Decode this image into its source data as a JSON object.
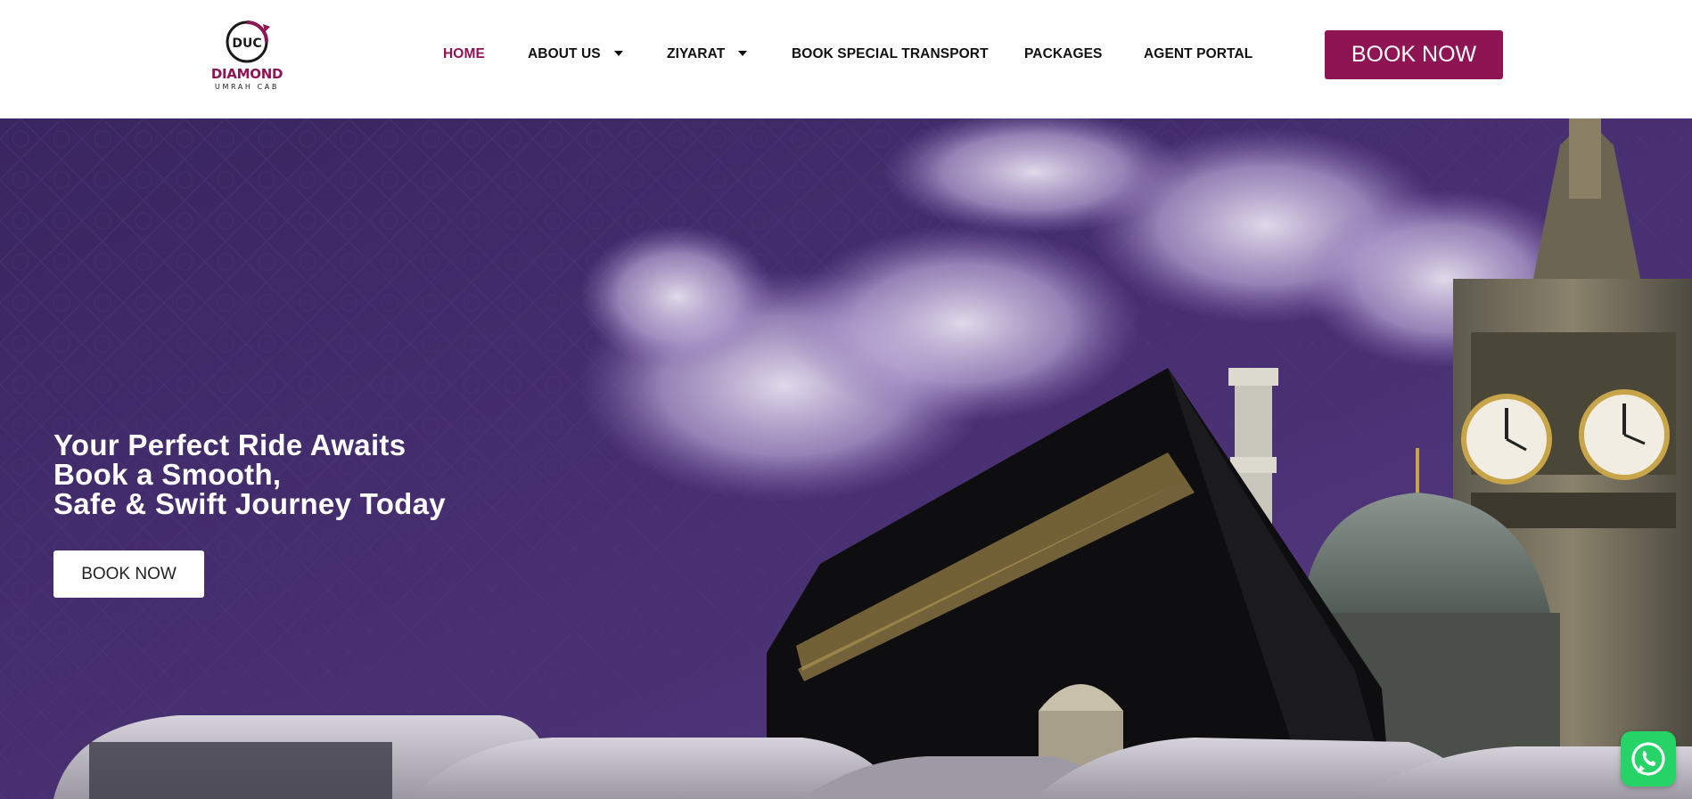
{
  "brand": {
    "name": "DIAMOND",
    "tagline": "UMRAH CAB",
    "mark_text": "DUC"
  },
  "nav": {
    "items": [
      {
        "label": "HOME",
        "active": true,
        "has_dropdown": false
      },
      {
        "label": "ABOUT US",
        "active": false,
        "has_dropdown": true
      },
      {
        "label": "ZIYARAT",
        "active": false,
        "has_dropdown": true
      },
      {
        "label": "BOOK SPECIAL TRANSPORT",
        "active": false,
        "has_dropdown": false
      },
      {
        "label": "PACKAGES",
        "active": false,
        "has_dropdown": false
      },
      {
        "label": "AGENT PORTAL",
        "active": false,
        "has_dropdown": false
      }
    ]
  },
  "header": {
    "cta_label": "BOOK NOW"
  },
  "hero": {
    "title_lines": [
      "Your Perfect Ride Awaits",
      "Book a Smooth,",
      "Safe & Swift Journey Today"
    ],
    "cta_label": "BOOK NOW"
  },
  "floating": {
    "whatsapp_icon": "whatsapp-icon"
  },
  "colors": {
    "brand": "#8e1454",
    "hero_background": "#3f2a67",
    "whatsapp": "#25d366"
  }
}
